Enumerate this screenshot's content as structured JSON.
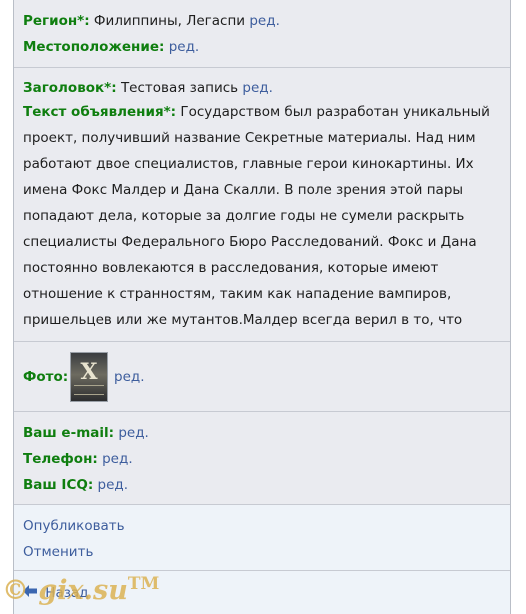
{
  "region": {
    "label": "Регион*:",
    "value": "Филиппины, Легаспи",
    "edit": "ред."
  },
  "location": {
    "label": "Местоположение:",
    "edit": "ред."
  },
  "title": {
    "label": "Заголовок*:",
    "value": "Тестовая запись",
    "edit": "ред."
  },
  "text": {
    "label": "Текст объявления*:",
    "value": "Государством был разработан уникальный проект, получивший название Секретные материалы. Над ним работают двое специалистов, главные герои кинокартины. Их имена Фокс Малдер и Дана Скалли. В поле зрения этой пары попадают дела, которые за долгие годы не сумели раскрыть специалисты Федерального Бюро Расследований. Фокс и Дана постоянно вовлекаются в расследования, которые имеют отношение к странностям, таким как нападение вампиров, пришельцев или же мутантов.Малдер всегда верил в то, что человечест",
    "edit": "ред."
  },
  "photo": {
    "label": "Фото:",
    "edit": "ред.",
    "thumb_letter": "X"
  },
  "email": {
    "label": "Ваш e-mail:",
    "edit": "ред."
  },
  "phone": {
    "label": "Телефон:",
    "edit": "ред."
  },
  "icq": {
    "label": "Ваш ICQ:",
    "edit": "ред."
  },
  "actions": {
    "publish": "Опубликовать",
    "cancel": "Отменить"
  },
  "back": {
    "label": "Назад"
  },
  "watermark": {
    "text": "© gix.su",
    "tm": "TM"
  }
}
